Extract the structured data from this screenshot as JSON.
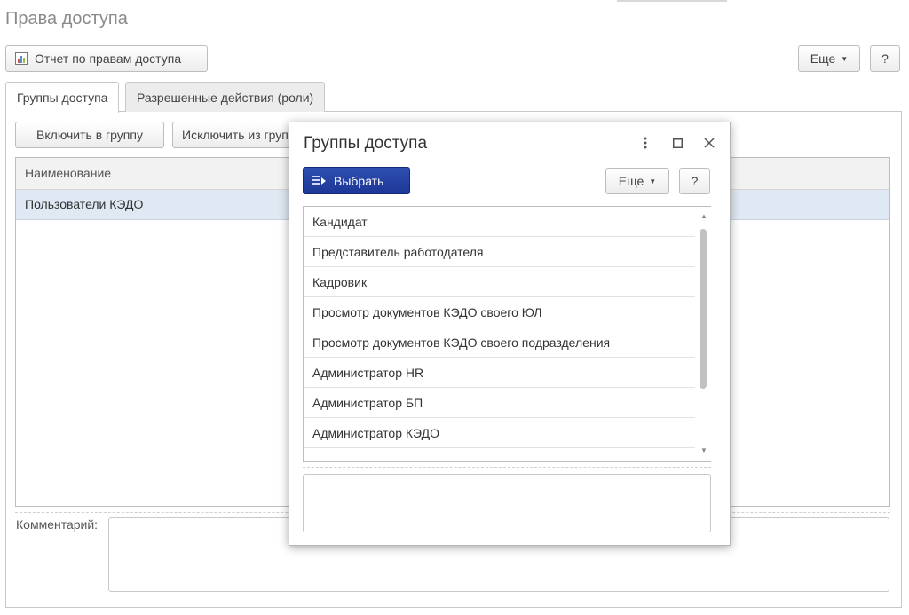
{
  "page": {
    "title": "Права доступа",
    "report_button": "Отчет по правам доступа",
    "more_button": "Еще",
    "help_button": "?"
  },
  "tabs": [
    {
      "label": "Группы доступа",
      "active": true
    },
    {
      "label": "Разрешенные действия (роли)",
      "active": false
    }
  ],
  "toolbar": {
    "include_button": "Включить в группу",
    "exclude_button": "Исключить из группы"
  },
  "grid": {
    "header": "Наименование",
    "rows": [
      "Пользователи КЭДО"
    ]
  },
  "comment": {
    "label": "Комментарий:",
    "value": ""
  },
  "dialog": {
    "title": "Группы доступа",
    "select_button": "Выбрать",
    "more_button": "Еще",
    "help_button": "?",
    "items": [
      "Кандидат",
      "Представитель работодателя",
      "Кадровик",
      "Просмотр документов КЭДО своего ЮЛ",
      "Просмотр документов КЭДО своего подразделения",
      "Администратор HR",
      "Администратор БП",
      "Администратор КЭДО"
    ],
    "description": ""
  },
  "icons": {
    "report": "report-chart-icon",
    "dropdown": "chevron-down-icon",
    "menu": "kebab-menu-icon",
    "maximize": "maximize-icon",
    "close": "close-icon",
    "select": "select-list-icon"
  },
  "colors": {
    "primary_button": "#1c3796",
    "selected_row": "#dfe8f3"
  }
}
